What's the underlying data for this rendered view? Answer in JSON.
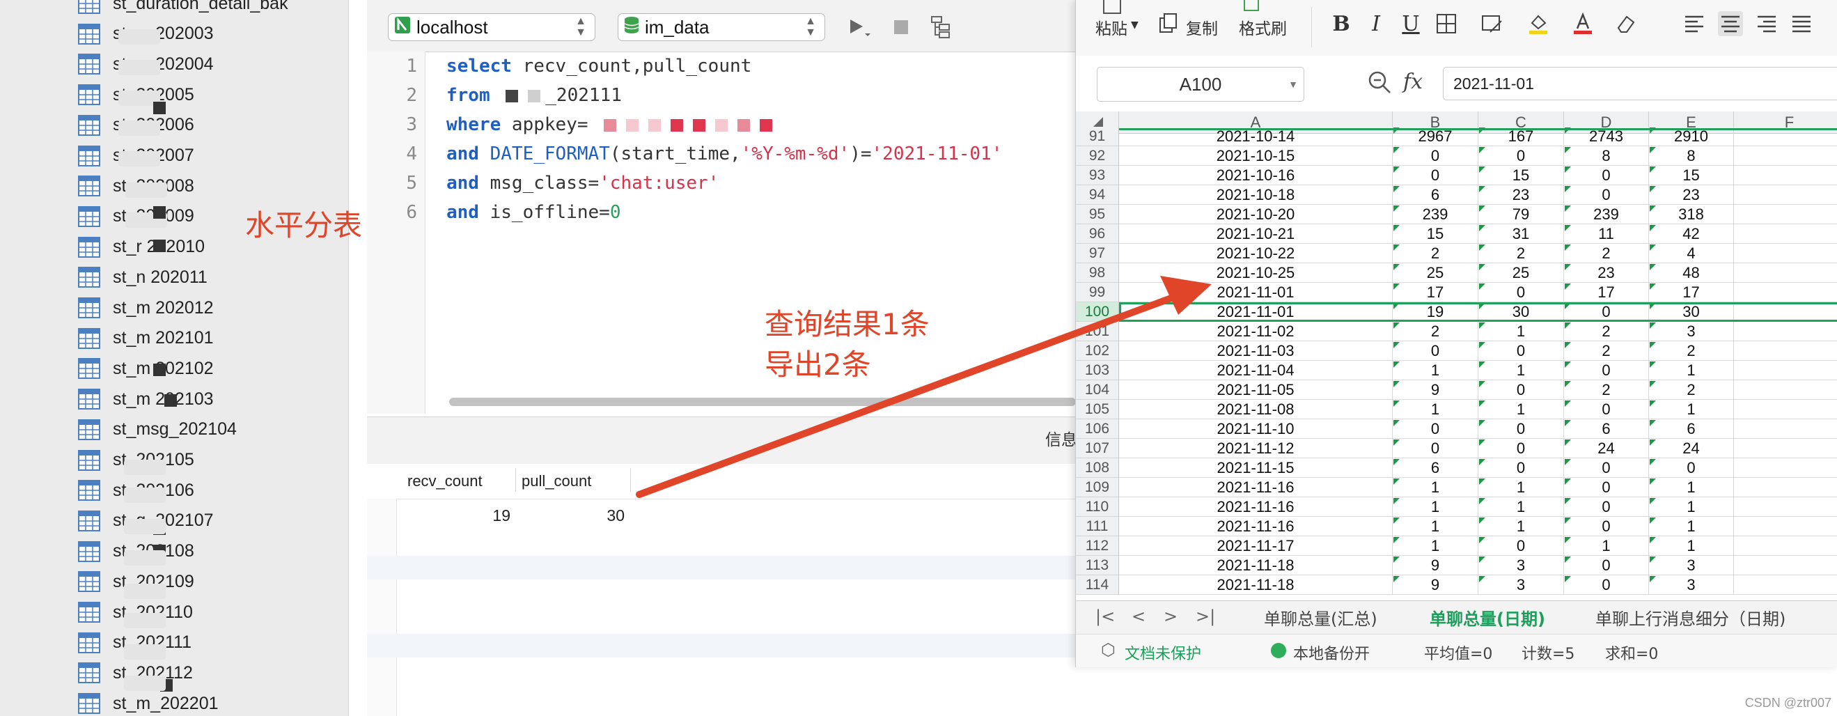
{
  "sidebar": {
    "items": [
      {
        "label": "st_duration_detail_bak"
      },
      {
        "label": "st_g_202003"
      },
      {
        "label": "st_g_202004"
      },
      {
        "label": "st_202005"
      },
      {
        "label": "st_202006"
      },
      {
        "label": "st_202007"
      },
      {
        "label": "st_202008"
      },
      {
        "label": "st_202009"
      },
      {
        "label": "st_r 202010"
      },
      {
        "label": "st_n 202011"
      },
      {
        "label": "st_m 202012"
      },
      {
        "label": "st_m 202101"
      },
      {
        "label": "st_m 202102"
      },
      {
        "label": "st_m 202103"
      },
      {
        "label": "st_msg_202104"
      },
      {
        "label": "st_202105"
      },
      {
        "label": "st_202106"
      },
      {
        "label": "st_g_202107"
      },
      {
        "label": "st_202108"
      },
      {
        "label": "st_202109"
      },
      {
        "label": "st_202110"
      },
      {
        "label": "st_202111"
      },
      {
        "label": "st_202112"
      },
      {
        "label": "st_m_202201"
      }
    ]
  },
  "annotations": {
    "horizontal_split": "水平分表",
    "result_line1": "查询结果1条",
    "result_line2": "导出2条"
  },
  "editor": {
    "connection": "localhost",
    "database": "im_data",
    "line_numbers": [
      "1",
      "2",
      "3",
      "4",
      "5",
      "6"
    ],
    "code": {
      "l1_kw": "select",
      "l1_rest": " recv_count,pull_count",
      "l2_kw": "from",
      "l2_rest": "_202111",
      "l3_kw": "where",
      "l3_rest": " appkey=",
      "l4_kw": "and",
      "l4_fn": "DATE_FORMAT",
      "l4_a": "(start_time,",
      "l4_s1": "'%Y-%m-%d'",
      "l4_b": ")=",
      "l4_s2": "'2021-11-01'",
      "l5_kw": "and",
      "l5_a": " msg_class=",
      "l5_s": "'chat:user'",
      "l6_kw": "and",
      "l6_a": " is_offline=",
      "l6_n": "0"
    },
    "info_tab": "信息",
    "result": {
      "columns": [
        "recv_count",
        "pull_count"
      ],
      "rows": [
        [
          "19",
          "30"
        ]
      ]
    }
  },
  "sheet": {
    "ribbon": {
      "paste": "粘贴",
      "copy": "复制",
      "format_painter": "格式刷",
      "bold": "B",
      "italic": "I",
      "underline": "U"
    },
    "name_box": "A100",
    "fx": "fx",
    "formula": "2021-11-01",
    "columns": [
      "A",
      "B",
      "C",
      "D",
      "E",
      "F"
    ],
    "rows": [
      {
        "n": "91",
        "cells": [
          "2021-10-14",
          "2967",
          "167",
          "2743",
          "2910"
        ]
      },
      {
        "n": "92",
        "cells": [
          "2021-10-15",
          "0",
          "0",
          "8",
          "8"
        ]
      },
      {
        "n": "93",
        "cells": [
          "2021-10-16",
          "0",
          "15",
          "0",
          "15"
        ]
      },
      {
        "n": "94",
        "cells": [
          "2021-10-18",
          "6",
          "23",
          "0",
          "23"
        ]
      },
      {
        "n": "95",
        "cells": [
          "2021-10-20",
          "239",
          "79",
          "239",
          "318"
        ]
      },
      {
        "n": "96",
        "cells": [
          "2021-10-21",
          "15",
          "31",
          "11",
          "42"
        ]
      },
      {
        "n": "97",
        "cells": [
          "2021-10-22",
          "2",
          "2",
          "2",
          "4"
        ]
      },
      {
        "n": "98",
        "cells": [
          "2021-10-25",
          "25",
          "25",
          "23",
          "48"
        ]
      },
      {
        "n": "99",
        "cells": [
          "2021-11-01",
          "17",
          "0",
          "17",
          "17"
        ]
      },
      {
        "n": "100",
        "cells": [
          "2021-11-01",
          "19",
          "30",
          "0",
          "30"
        ]
      },
      {
        "n": "101",
        "cells": [
          "2021-11-02",
          "2",
          "1",
          "2",
          "3"
        ]
      },
      {
        "n": "102",
        "cells": [
          "2021-11-03",
          "0",
          "0",
          "2",
          "2"
        ]
      },
      {
        "n": "103",
        "cells": [
          "2021-11-04",
          "1",
          "1",
          "0",
          "1"
        ]
      },
      {
        "n": "104",
        "cells": [
          "2021-11-05",
          "9",
          "0",
          "2",
          "2"
        ]
      },
      {
        "n": "105",
        "cells": [
          "2021-11-08",
          "1",
          "1",
          "0",
          "1"
        ]
      },
      {
        "n": "106",
        "cells": [
          "2021-11-10",
          "0",
          "0",
          "6",
          "6"
        ]
      },
      {
        "n": "107",
        "cells": [
          "2021-11-12",
          "0",
          "0",
          "24",
          "24"
        ]
      },
      {
        "n": "108",
        "cells": [
          "2021-11-15",
          "6",
          "0",
          "0",
          "0"
        ]
      },
      {
        "n": "109",
        "cells": [
          "2021-11-16",
          "1",
          "1",
          "0",
          "1"
        ]
      },
      {
        "n": "110",
        "cells": [
          "2021-11-16",
          "1",
          "1",
          "0",
          "1"
        ]
      },
      {
        "n": "111",
        "cells": [
          "2021-11-16",
          "1",
          "1",
          "0",
          "1"
        ]
      },
      {
        "n": "112",
        "cells": [
          "2021-11-17",
          "1",
          "0",
          "1",
          "1"
        ]
      },
      {
        "n": "113",
        "cells": [
          "2021-11-18",
          "9",
          "3",
          "0",
          "3"
        ]
      },
      {
        "n": "114",
        "cells": [
          "2021-11-18",
          "9",
          "3",
          "0",
          "3"
        ]
      }
    ],
    "selected_row": "100",
    "tabs": [
      "单聊总量(汇总)",
      "单聊总量(日期)",
      "单聊上行消息细分（日期)"
    ],
    "active_tab": "单聊总量(日期)",
    "status": {
      "protect": "文档未保护",
      "backup": "本地备份开",
      "average": "平均值=0",
      "count": "计数=5",
      "sum": "求和=0"
    },
    "accent": "#1aa05a"
  },
  "watermark": "CSDN @ztr007",
  "colors": {
    "keyword": "#1f5fc4",
    "string": "#d6334a",
    "annotation": "#e0452a"
  }
}
